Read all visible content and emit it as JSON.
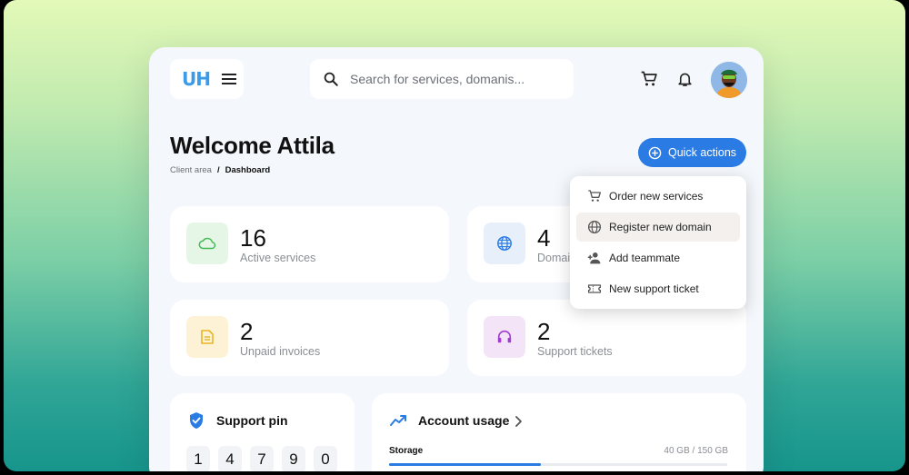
{
  "header": {
    "logo_text": "UH",
    "search": {
      "placeholder": "Search for services, domanis..."
    }
  },
  "page": {
    "title": "Welcome Attila",
    "breadcrumb": {
      "root": "Client area",
      "separator": "/",
      "current": "Dashboard"
    }
  },
  "quick_actions": {
    "label": "Quick actions",
    "menu": [
      {
        "label": "Order new services",
        "icon": "cart-icon"
      },
      {
        "label": "Register new domain",
        "icon": "globe-icon",
        "highlighted": true
      },
      {
        "label": "Add teammate",
        "icon": "person-add-icon"
      },
      {
        "label": "New support ticket",
        "icon": "ticket-icon"
      }
    ]
  },
  "stats": [
    {
      "value": "16",
      "label": "Active services",
      "icon": "cloud-icon",
      "color": "#3fb950"
    },
    {
      "value": "4",
      "label": "Domains",
      "icon": "globe-icon",
      "color": "#2a7be4"
    },
    {
      "value": "2",
      "label": "Unpaid invoices",
      "icon": "invoice-icon",
      "color": "#e6b422"
    },
    {
      "value": "2",
      "label": "Support tickets",
      "icon": "headset-icon",
      "color": "#a23bd0"
    }
  ],
  "support_pin": {
    "title": "Support pin",
    "digits": [
      "1",
      "4",
      "7",
      "9",
      "0"
    ]
  },
  "account_usage": {
    "title": "Account usage",
    "storage_label": "Storage",
    "storage_value": "40 GB / 150 GB",
    "storage_fraction": 0.45
  },
  "colors": {
    "accent": "#2a7be4",
    "background": "#f4f7fb"
  }
}
